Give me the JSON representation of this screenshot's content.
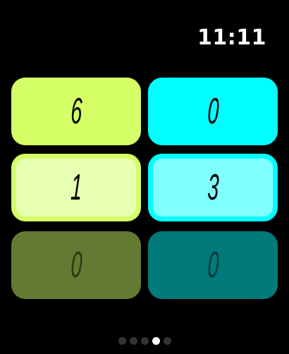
{
  "status_bar": {
    "time": "11:11"
  },
  "colors": {
    "background": "#000000",
    "lime": "#d4ff66",
    "lime_light": "#e6ffb3",
    "lime_dark": "#637a33",
    "cyan": "#00ffff",
    "cyan_light": "#80ffff",
    "teal_dark": "#007a7a",
    "digit": "#000000",
    "digit_dim": "#2a3a12"
  },
  "tiles": [
    {
      "value": "6",
      "row": 0,
      "col": 0,
      "style": "lime"
    },
    {
      "value": "0",
      "row": 0,
      "col": 1,
      "style": "cyan"
    },
    {
      "value": "1",
      "row": 1,
      "col": 0,
      "style": "lime-selected"
    },
    {
      "value": "3",
      "row": 1,
      "col": 1,
      "style": "cyan-selected"
    },
    {
      "value": "0",
      "row": 2,
      "col": 0,
      "style": "lime-dim"
    },
    {
      "value": "0",
      "row": 2,
      "col": 1,
      "style": "teal-dim"
    }
  ],
  "page_indicator": {
    "total": 5,
    "current": 4
  }
}
